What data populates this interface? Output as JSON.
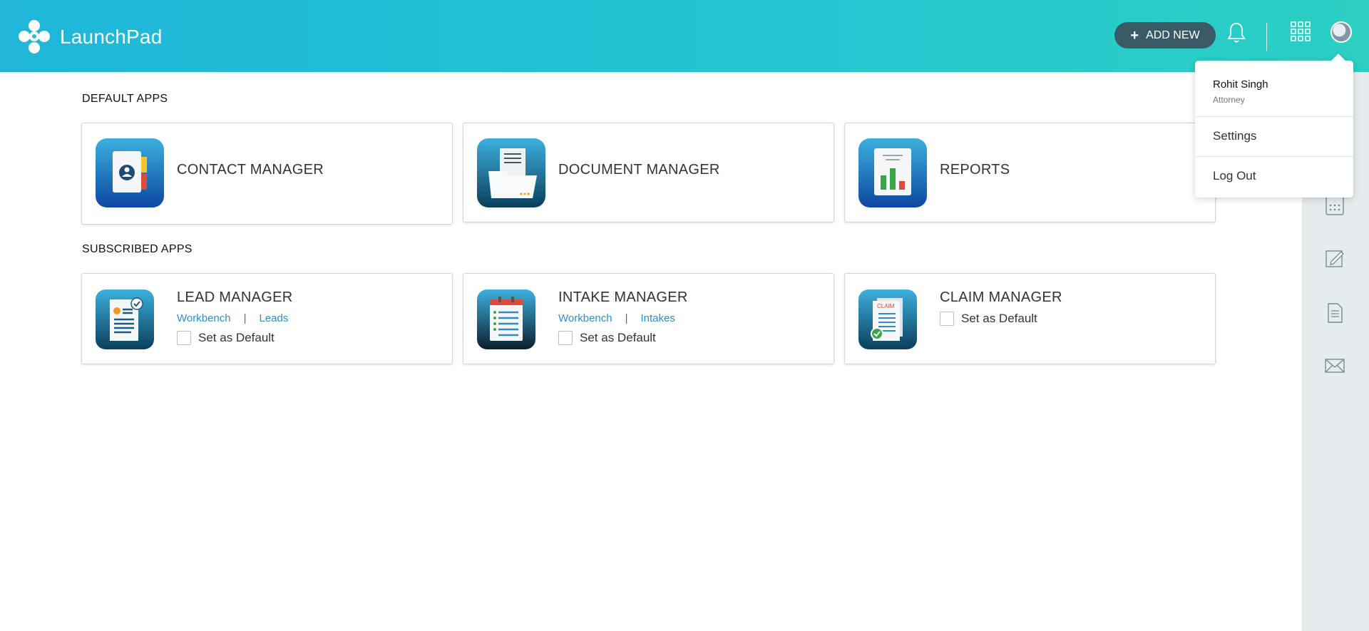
{
  "header": {
    "app_name": "LaunchPad",
    "add_new_label": "ADD NEW",
    "icons": [
      "launchpad-logo-icon",
      "bell-icon",
      "apps-grid-icon",
      "avatar"
    ]
  },
  "sections": {
    "default_apps": "DEFAULT APPS",
    "subscribed_apps": "SUBSCRIBED APPS"
  },
  "default_apps": [
    {
      "title": "CONTACT MANAGER",
      "icon": "contact-manager-icon"
    },
    {
      "title": "DOCUMENT MANAGER",
      "icon": "document-manager-icon"
    },
    {
      "title": "REPORTS",
      "icon": "reports-icon"
    }
  ],
  "subscribed_apps": [
    {
      "title": "LEAD MANAGER",
      "links": [
        "Workbench",
        "Leads"
      ],
      "default_label": "Set as Default",
      "icon": "lead-manager-icon"
    },
    {
      "title": "INTAKE MANAGER",
      "links": [
        "Workbench",
        "Intakes"
      ],
      "default_label": "Set as Default",
      "icon": "intake-manager-icon"
    },
    {
      "title": "CLAIM MANAGER",
      "default_label": "Set as Default",
      "icon": "claim-manager-icon",
      "icon_text": "CLAIM"
    }
  ],
  "user_menu": {
    "name": "Rohit Singh",
    "role": "Attorney",
    "settings": "Settings",
    "logout": "Log Out"
  },
  "right_sidebar_icons": [
    "calculator-icon",
    "edit-icon",
    "document-icon",
    "mail-icon"
  ],
  "colors": {
    "header_gradient_start": "#1fb6d9",
    "header_gradient_end": "#2ccfc2",
    "add_new_button": "#3a5a66",
    "link": "#2d8fc9",
    "right_sidebar": "#e6ecee"
  }
}
